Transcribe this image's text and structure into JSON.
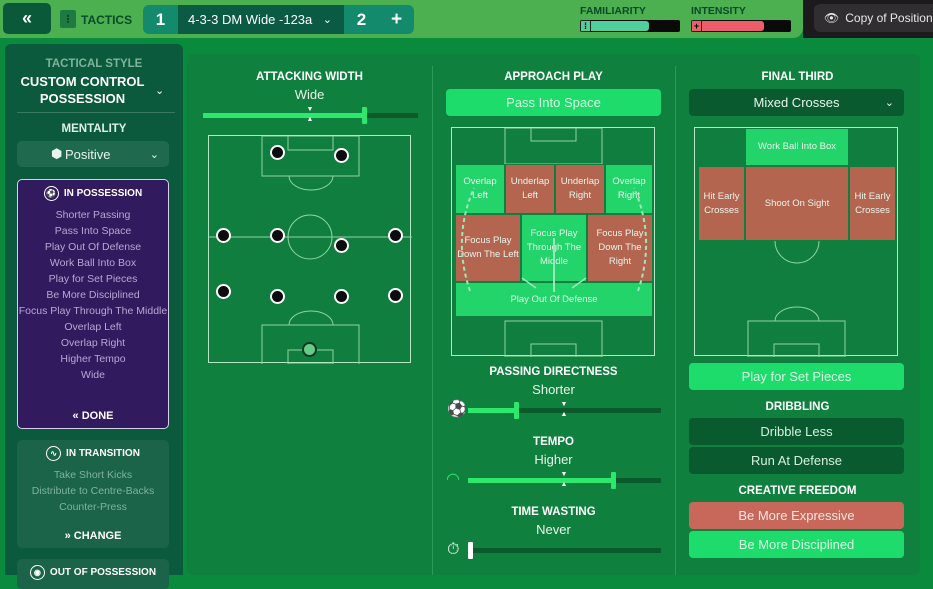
{
  "topbar": {
    "back_icon": "double-chevron-left-icon",
    "back_label": "«",
    "tactics_label": "TACTICS",
    "tabs": [
      {
        "label": "1"
      },
      {
        "label": "4-3-3 DM Wide -123a",
        "selected": true
      },
      {
        "label": "2"
      }
    ],
    "add_tab_label": "+",
    "familiarity": {
      "label": "FAMILIARITY",
      "value": 0.65,
      "color": "#4ecf9c"
    },
    "intensity": {
      "label": "INTENSITY",
      "value": 0.7,
      "color": "#ee5e68"
    },
    "copy_button": {
      "label": "Copy of Position",
      "icon": "eye-icon"
    }
  },
  "sidebar": {
    "tactical_style_label": "TACTICAL STYLE",
    "tactical_style_value": "CUSTOM CONTROL POSSESSION",
    "mentality_label": "MENTALITY",
    "mentality_value": "Positive",
    "in_possession": {
      "title": "IN POSSESSION",
      "items": [
        "Shorter Passing",
        "Pass Into Space",
        "Play Out Of Defense",
        "Work Ball Into Box",
        "Play for Set Pieces",
        "Be More Disciplined",
        "Focus Play Through The Middle",
        "Overlap Left",
        "Overlap Right",
        "Higher Tempo",
        "Wide"
      ],
      "action": "DONE"
    },
    "in_transition": {
      "title": "IN TRANSITION",
      "items": [
        "Take Short Kicks",
        "Distribute to Centre-Backs",
        "Counter-Press"
      ],
      "action": "CHANGE"
    },
    "out_of_possession": {
      "title": "OUT OF POSSESSION"
    }
  },
  "attacking_width": {
    "title": "ATTACKING WIDTH",
    "value": "Wide",
    "level": 0.75
  },
  "approach_play": {
    "title": "APPROACH PLAY",
    "selected": "Pass Into Space",
    "zones": {
      "overlap_left": "Overlap Left",
      "underlap_left": "Underlap Left",
      "underlap_right": "Underlap Right",
      "overlap_right": "Overlap Right",
      "focus_left": "Focus Play Down The Left",
      "focus_middle": "Focus Play Through The Middle",
      "focus_right": "Focus Play Down The Right",
      "play_out": "Play Out Of Defense"
    }
  },
  "passing_directness": {
    "title": "PASSING DIRECTNESS",
    "value": "Shorter",
    "level": 0.25
  },
  "tempo": {
    "title": "TEMPO",
    "value": "Higher",
    "level": 0.75
  },
  "time_wasting": {
    "title": "TIME WASTING",
    "value": "Never",
    "level": 0.0
  },
  "final_third": {
    "title": "FINAL THIRD",
    "selected": "Mixed Crosses",
    "zones": {
      "work_ball": "Work Ball Into Box",
      "hit_early_left": "Hit Early Crosses",
      "shoot_on_sight": "Shoot On Sight",
      "hit_early_right": "Hit Early Crosses"
    },
    "set_pieces_button": "Play for Set Pieces"
  },
  "dribbling": {
    "title": "DRIBBLING",
    "options": [
      "Dribble Less",
      "Run At Defense"
    ]
  },
  "creative_freedom": {
    "title": "CREATIVE FREEDOM",
    "options": [
      "Be More Expressive",
      "Be More Disciplined"
    ]
  }
}
